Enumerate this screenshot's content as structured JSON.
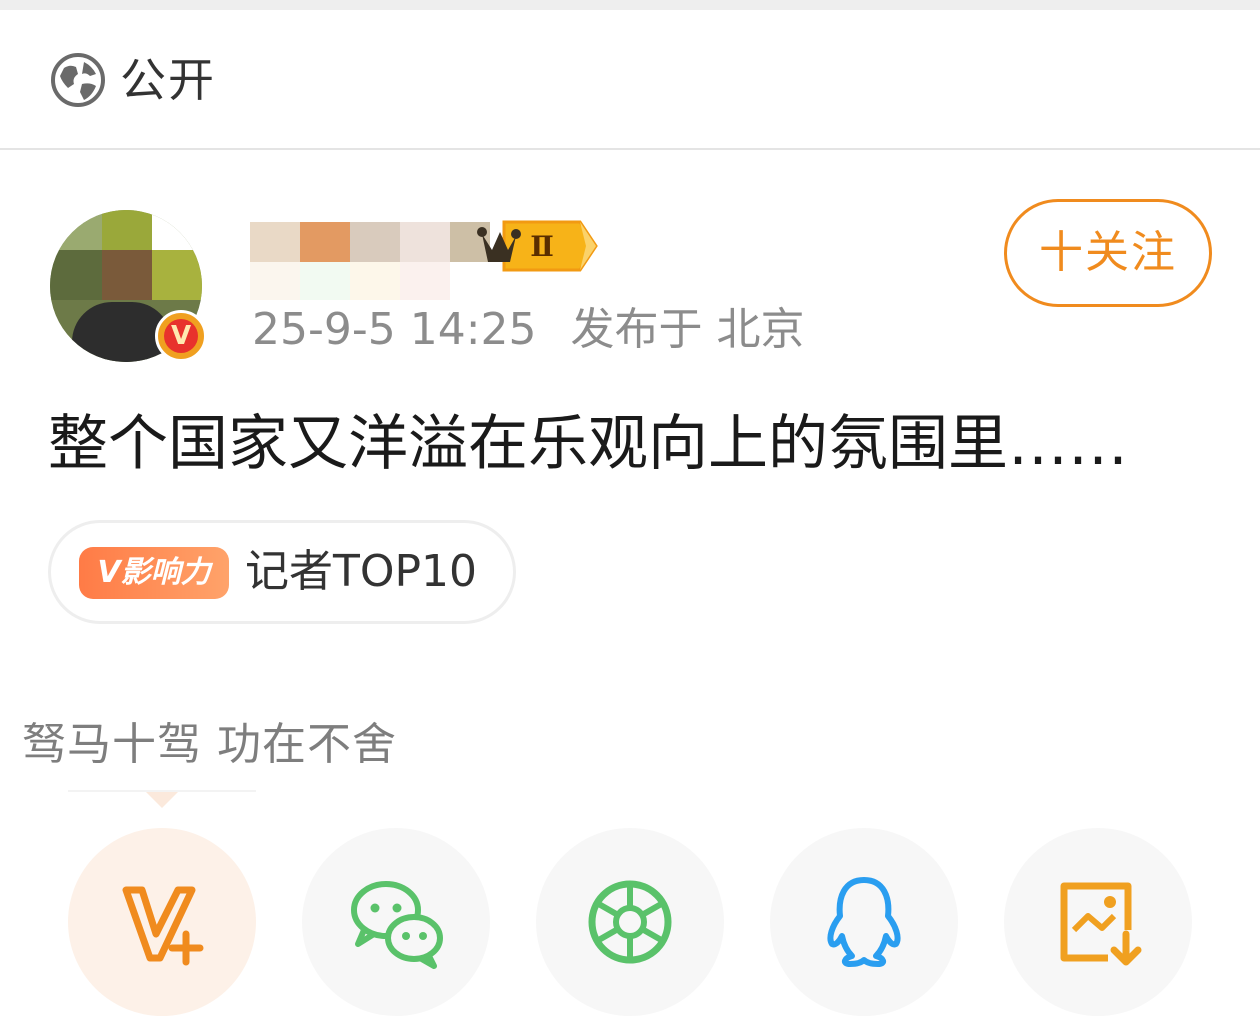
{
  "privacy": {
    "label": "公开",
    "icon": "globe-icon"
  },
  "post": {
    "follow_label": "十关注",
    "time": "25-9-5 14:25",
    "location": "发布于 北京",
    "text": "整个国家又洋溢在乐观向上的氛围里……",
    "badge_level": "Ⅱ"
  },
  "influence": {
    "badge": "V影响力",
    "label": "记者TOP10"
  },
  "share": {
    "tip": "驽马十驾 功在不舍",
    "buttons": [
      {
        "name": "weibo-repost",
        "icon": "weibo-v-plus-icon"
      },
      {
        "name": "wechat",
        "icon": "wechat-icon"
      },
      {
        "name": "moments",
        "icon": "aperture-icon"
      },
      {
        "name": "qq",
        "icon": "qq-penguin-icon"
      },
      {
        "name": "save-image",
        "icon": "image-download-icon"
      }
    ]
  },
  "colors": {
    "accent": "#f08b1e",
    "wechat": "#5ac26a",
    "qq": "#2a9ef0",
    "text": "#1a1a1a",
    "muted": "#8c8c8c"
  }
}
